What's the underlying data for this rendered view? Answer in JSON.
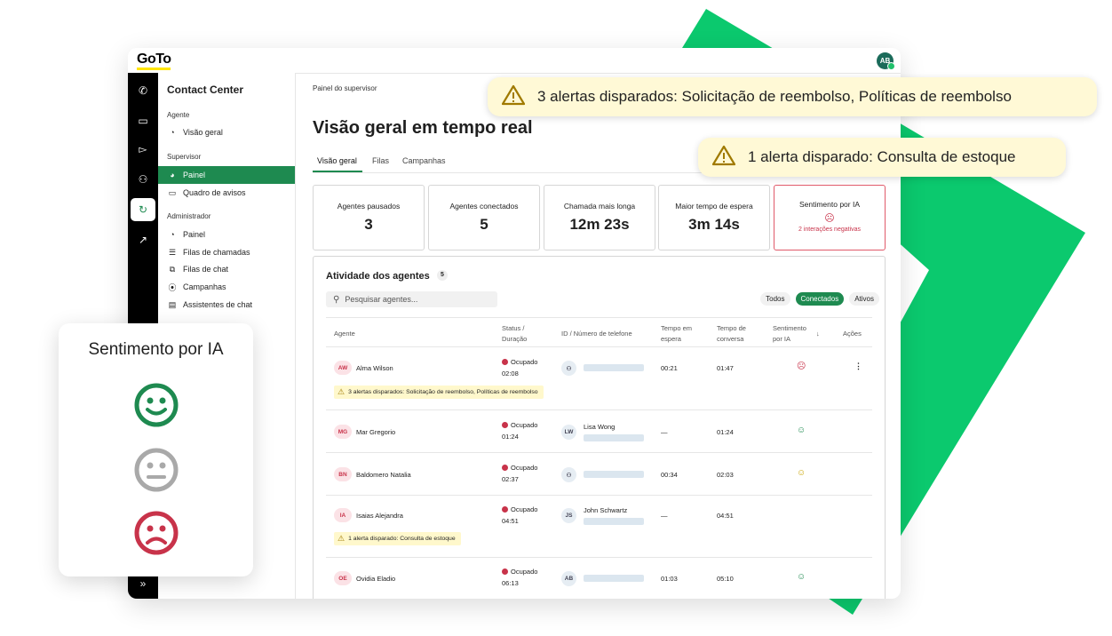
{
  "app": {
    "logo": "GoTo",
    "user_initials": "AB"
  },
  "rail_icons": [
    "phone-icon",
    "chat-icon",
    "video-icon",
    "contacts-icon",
    "headset-icon",
    "analytics-icon"
  ],
  "sidebar": {
    "title": "Contact Center",
    "sections": [
      {
        "label": "Agente",
        "items": [
          {
            "label": "Visão geral",
            "icon": "gauge-icon"
          }
        ]
      },
      {
        "label": "Supervisor",
        "items": [
          {
            "label": "Painel",
            "icon": "dashboard-icon",
            "selected": true
          },
          {
            "label": "Quadro de avisos",
            "icon": "board-icon"
          }
        ]
      },
      {
        "label": "Administrador",
        "items": [
          {
            "label": "Painel",
            "icon": "gauge-icon"
          },
          {
            "label": "Filas de chamadas",
            "icon": "list-icon"
          },
          {
            "label": "Filas de chat",
            "icon": "chat-queue-icon"
          },
          {
            "label": "Campanhas",
            "icon": "broadcast-icon"
          },
          {
            "label": "Assistentes de chat",
            "icon": "bot-icon"
          }
        ]
      }
    ],
    "expand_glyph": "»"
  },
  "main": {
    "breadcrumb": "Painel do supervisor",
    "title": "Visão geral em tempo real",
    "tabs": [
      "Visão geral",
      "Filas",
      "Campanhas"
    ],
    "active_tab": "Visão geral"
  },
  "kpis": [
    {
      "label": "Agentes pausados",
      "value": "3"
    },
    {
      "label": "Agentes conectados",
      "value": "5"
    },
    {
      "label": "Chamada mais longa",
      "value": "12m 23s"
    },
    {
      "label": "Maior tempo de espera",
      "value": "3m 14s"
    },
    {
      "label": "Sentimento por IA",
      "note": "2 interações negativas"
    }
  ],
  "activity": {
    "title": "Atividade dos agentes",
    "count": "5",
    "search_placeholder": "Pesquisar agentes...",
    "filters": [
      "Todos",
      "Conectados",
      "Ativos"
    ],
    "active_filter": "Conectados",
    "columns": [
      "Agente",
      "Status / Duração",
      "ID / Número de telefone",
      "Tempo em espera",
      "Tempo de conversa",
      "Sentimento por IA",
      "Ações"
    ],
    "rows": [
      {
        "initials": "AW",
        "name": "Alma Wilson",
        "status": "Ocupado",
        "duration": "02:08",
        "id_initials": "",
        "id_name": "",
        "hold": "00:21",
        "talk": "01:47",
        "sentiment": "negative",
        "alert": "3 alertas disparados: Solicitação de reembolso, Políticas de reembolso"
      },
      {
        "initials": "MG",
        "name": "Mar Gregorio",
        "status": "Ocupado",
        "duration": "01:24",
        "id_initials": "LW",
        "id_name": "Lisa Wong",
        "hold": "—",
        "talk": "01:24",
        "sentiment": "positive",
        "alert": ""
      },
      {
        "initials": "BN",
        "name": "Baldomero Natalia",
        "status": "Ocupado",
        "duration": "02:37",
        "id_initials": "",
        "id_name": "",
        "hold": "00:34",
        "talk": "02:03",
        "sentiment": "neutral",
        "alert": ""
      },
      {
        "initials": "IA",
        "name": "Isaias Alejandra",
        "status": "Ocupado",
        "duration": "04:51",
        "id_initials": "JS",
        "id_name": "John Schwartz",
        "hold": "—",
        "talk": "04:51",
        "sentiment": "",
        "alert": "1 alerta disparado: Consulta de estoque"
      },
      {
        "initials": "OE",
        "name": "Ovidia Eladio",
        "status": "Ocupado",
        "duration": "06:13",
        "id_initials": "AB",
        "id_name": "",
        "hold": "01:03",
        "talk": "05:10",
        "sentiment": "positive",
        "alert": ""
      }
    ]
  },
  "toasts": [
    "3 alertas disparados: Solicitação de reembolso, Políticas de reembolso",
    "1 alerta disparado: Consulta de estoque"
  ],
  "sentiment_card": {
    "title": "Sentimento por IA",
    "faces": [
      "positive",
      "neutral",
      "negative"
    ]
  },
  "colors": {
    "brand_green": "#1e8a50",
    "accent_green": "#0bc96e",
    "negative": "#c8334a",
    "neutral": "#a9a9a9",
    "logo_yellow": "#ffe500",
    "alert_bg": "#fff9d6"
  }
}
